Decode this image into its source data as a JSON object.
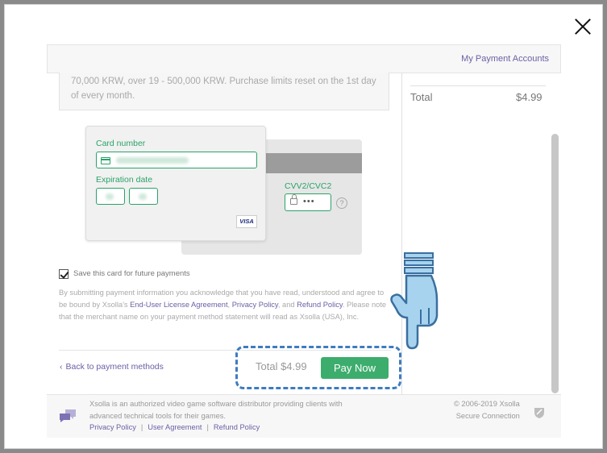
{
  "header": {
    "payment_accounts_link": "My Payment Accounts"
  },
  "limits": {
    "text": "70,000 KRW, over 19 - 500,000 KRW. Purchase limits reset on the 1st day of every month."
  },
  "summary": {
    "total_label": "Total",
    "total_value": "$4.99"
  },
  "card_form": {
    "card_number_label": "Card number",
    "expiration_label": "Expiration date",
    "cvv_label": "CVV2/CVC2",
    "cvv_value": "•••",
    "help_glyph": "?",
    "brand": "VISA",
    "icons": [
      "card-icon",
      "lock-icon",
      "help-icon"
    ]
  },
  "save_card": {
    "label": "Save this card for future payments",
    "checked": true
  },
  "legal": {
    "part1": "By submitting payment information you acknowledge that you have read, understood and agree to be bound by Xsolla's ",
    "eula": "End-User License Agreement",
    "sep1": ", ",
    "privacy": "Privacy Policy",
    "sep2": ", and ",
    "refund": "Refund Policy",
    "part2": ". Please note that the merchant name on your payment method statement will read as Xsolla (USA), Inc."
  },
  "actions": {
    "back_chevron": "‹",
    "back_label": "Back to payment methods",
    "total_text": "Total $4.99",
    "pay_label": "Pay Now"
  },
  "footer": {
    "description": "Xsolla is an authorized video game software distributor providing clients with advanced technical tools for their games.",
    "links": [
      "Privacy Policy",
      "User Agreement",
      "Refund Policy"
    ],
    "separator": "|",
    "copyright": "© 2006-2019 Xsolla",
    "secure": "Secure Connection"
  },
  "colors": {
    "accent_green": "#3dad6d",
    "field_green": "#2aa36a",
    "link_purple": "#6b5fa5",
    "highlight_blue": "#3d7cbf",
    "hand_blue": "#a8d3ef"
  }
}
